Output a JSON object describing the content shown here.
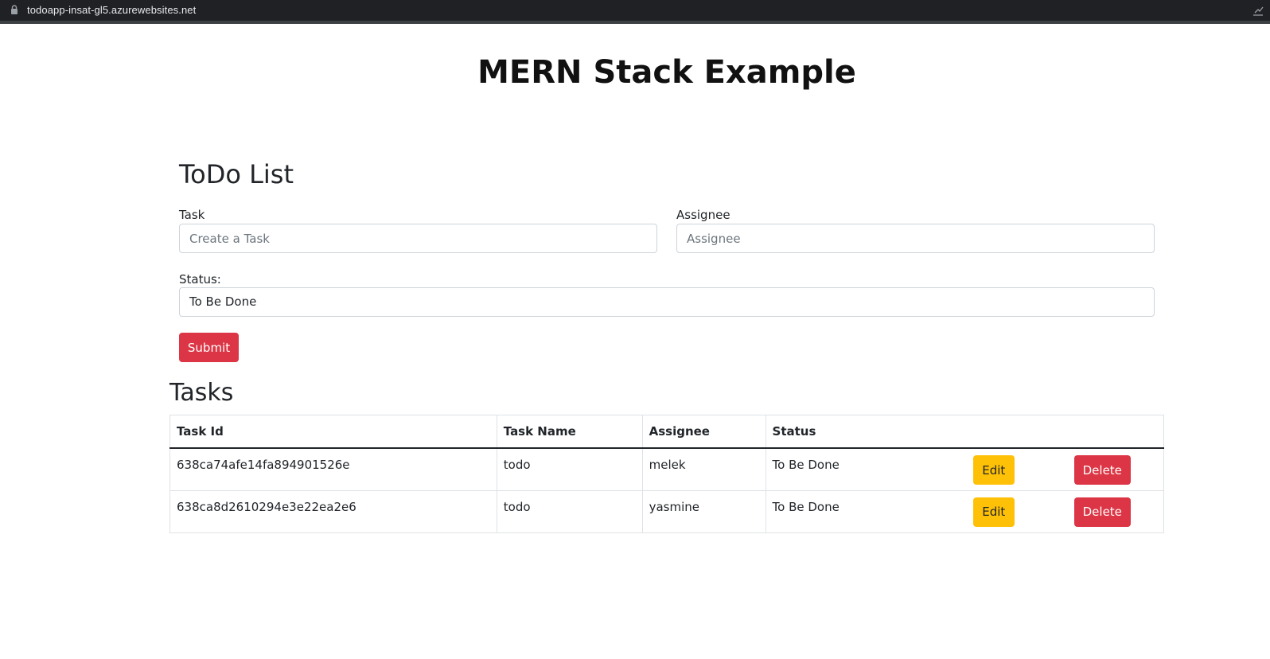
{
  "browser": {
    "url": "todoapp-insat-gl5.azurewebsites.net"
  },
  "page": {
    "title": "MERN Stack Example"
  },
  "form": {
    "title": "ToDo List",
    "task_label": "Task",
    "task_placeholder": "Create a Task",
    "task_value": "",
    "assignee_label": "Assignee",
    "assignee_placeholder": "Assignee",
    "assignee_value": "",
    "status_label": "Status:",
    "status_value": "To Be Done",
    "submit_label": "Submit"
  },
  "tasks": {
    "title": "Tasks",
    "columns": [
      "Task Id",
      "Task Name",
      "Assignee",
      "Status"
    ],
    "rows": [
      {
        "id": "638ca74afe14fa894901526e",
        "name": "todo",
        "assignee": "melek",
        "status": "To Be Done",
        "edit_label": "Edit",
        "delete_label": "Delete"
      },
      {
        "id": "638ca8d2610294e3e22ea2e6",
        "name": "todo",
        "assignee": "yasmine",
        "status": "To Be Done",
        "edit_label": "Edit",
        "delete_label": "Delete"
      }
    ]
  },
  "colors": {
    "danger": "#dc3545",
    "warning": "#ffc107",
    "browser_bar": "#202124"
  },
  "icons": {
    "address_bar": "lock-icon",
    "toolbar_right": "extension-icon"
  }
}
